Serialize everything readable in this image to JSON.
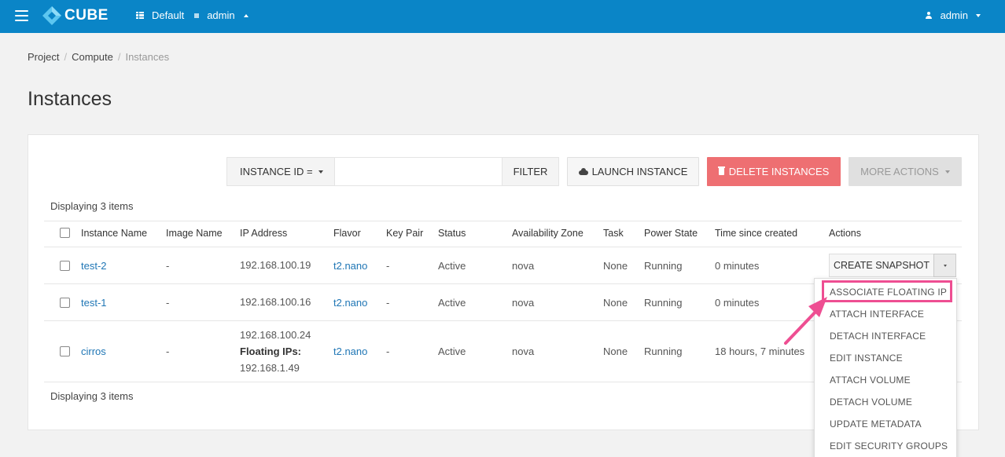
{
  "header": {
    "logo_text": "CUBE",
    "domain": "Default",
    "project": "admin",
    "user": "admin",
    "brand_color": "#0a85c7"
  },
  "breadcrumb": {
    "items": [
      "Project",
      "Compute",
      "Instances"
    ],
    "separator": "/"
  },
  "page_title": "Instances",
  "toolbar": {
    "filter_field": "INSTANCE ID =",
    "filter_value": "",
    "filter_button": "FILTER",
    "launch_button": "LAUNCH INSTANCE",
    "delete_button": "DELETE INSTANCES",
    "more_button": "MORE ACTIONS",
    "delete_color": "#ee6f72"
  },
  "display_count_top": "Displaying 3 items",
  "display_count_bottom": "Displaying 3 items",
  "table": {
    "columns": [
      "Instance Name",
      "Image Name",
      "IP Address",
      "Flavor",
      "Key Pair",
      "Status",
      "Availability Zone",
      "Task",
      "Power State",
      "Time since created",
      "Actions"
    ],
    "rows": [
      {
        "name": "test-2",
        "image": "-",
        "ip": "192.168.100.19",
        "flavor": "t2.nano",
        "keypair": "-",
        "status": "Active",
        "az": "nova",
        "task": "None",
        "power": "Running",
        "time": "0 minutes"
      },
      {
        "name": "test-1",
        "image": "-",
        "ip": "192.168.100.16",
        "flavor": "t2.nano",
        "keypair": "-",
        "status": "Active",
        "az": "nova",
        "task": "None",
        "power": "Running",
        "time": "0 minutes"
      },
      {
        "name": "cirros",
        "image": "-",
        "ip": "192.168.100.24",
        "floating_label": "Floating IPs:",
        "floating_ip": "192.168.1.49",
        "flavor": "t2.nano",
        "keypair": "-",
        "status": "Active",
        "az": "nova",
        "task": "None",
        "power": "Running",
        "time": "18 hours, 7 minutes"
      }
    ]
  },
  "actions": {
    "primary": "CREATE SNAPSHOT",
    "menu": [
      "ASSOCIATE FLOATING IP",
      "ATTACH INTERFACE",
      "DETACH INTERFACE",
      "EDIT INSTANCE",
      "ATTACH VOLUME",
      "DETACH VOLUME",
      "UPDATE METADATA",
      "EDIT SECURITY GROUPS"
    ],
    "highlight_color": "#ee4e92"
  }
}
